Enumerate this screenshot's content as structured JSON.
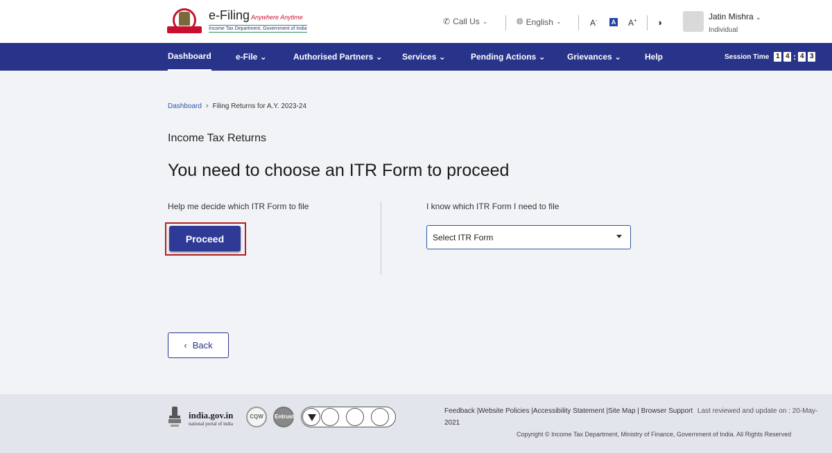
{
  "header": {
    "logo_title": "e-Filing",
    "logo_tagline": "Anywhere Anytime",
    "logo_subtitle": "Income Tax Department, Government of India",
    "call_us": "Call Us",
    "language": "English",
    "font_decrease": "A",
    "font_normal": "A",
    "font_increase": "A",
    "user_name": "Jatin Mishra",
    "user_role": "Individual"
  },
  "nav": {
    "items": [
      {
        "label": "Dashboard"
      },
      {
        "label": "e-File"
      },
      {
        "label": "Authorised Partners"
      },
      {
        "label": "Services"
      },
      {
        "label": "Pending Actions"
      },
      {
        "label": "Grievances"
      },
      {
        "label": "Help"
      }
    ],
    "session_label": "Session Time",
    "session_digits": [
      "1",
      "4",
      "4",
      "3"
    ]
  },
  "breadcrumb": {
    "home": "Dashboard",
    "current": "Filing Returns for A.Y. 2023-24"
  },
  "main": {
    "section_title": "Income Tax Returns",
    "heading": "You need to choose an ITR Form to proceed",
    "left_label": "Help me decide which ITR Form to file",
    "proceed_label": "Proceed",
    "right_label": "I know which ITR Form I need to file",
    "select_value": "Select ITR Form",
    "back_label": "Back"
  },
  "footer": {
    "gov_title": "india.gov.in",
    "gov_subtitle": "national portal of india",
    "badge_cqw": "CQW",
    "badge_entrust": "Entrust",
    "links": "Feedback |Website Policies |Accessibility Statement |Site Map | Browser Support",
    "reviewed": "Last reviewed and update on : 20-May-",
    "reviewed_year": "2021",
    "copyright": "Copyright © Income Tax Department, Ministry of Finance, Government of India. All Rights Reserved"
  },
  "colors": {
    "nav_bg": "#28348a",
    "primary_button": "#2e3a96",
    "highlight_outline": "#b01e22",
    "link": "#2c56a8"
  }
}
